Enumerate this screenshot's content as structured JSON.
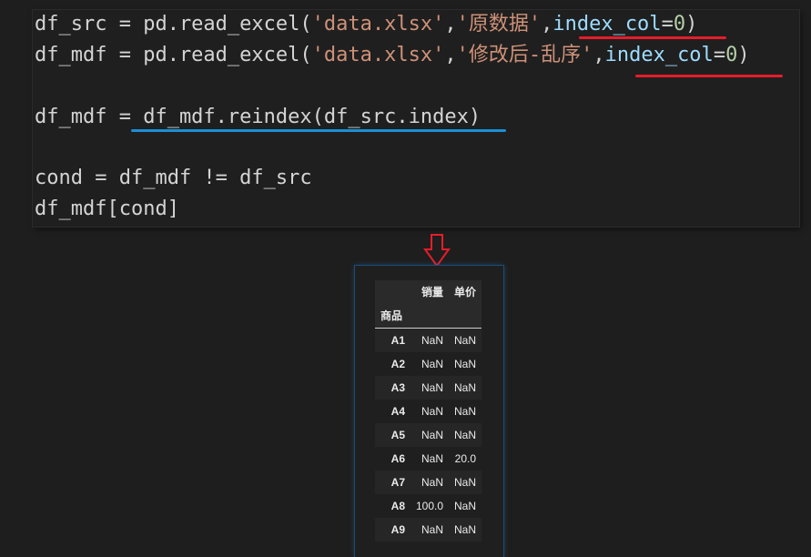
{
  "code": {
    "line1": {
      "a": "df_src = pd.read_excel(",
      "s1": "'data.xlsx'",
      "c1": ",",
      "s2": "'原数据'",
      "c2": ",",
      "kw": "index_col",
      "eq": "=",
      "num": "0",
      "end": ")"
    },
    "line2": {
      "a": "df_mdf = pd.read_excel(",
      "s1": "'data.xlsx'",
      "c1": ",",
      "s2": "'修改后-乱序'",
      "c2": ",",
      "kw": "index_col",
      "eq": "=",
      "num": "0",
      "end": ")"
    },
    "line3": "df_mdf = df_mdf.reindex(df_src.index)",
    "line4": "cond = df_mdf != df_src",
    "line5": "df_mdf[cond]"
  },
  "colors": {
    "red_underline": "#e51d2a",
    "blue_underline": "#1c8fd6",
    "arrow": "#e51d2a"
  },
  "dataframe": {
    "columns": [
      "销量",
      "单价"
    ],
    "index_name": "商品",
    "rows": [
      {
        "idx": "A1",
        "v1": "NaN",
        "v2": "NaN"
      },
      {
        "idx": "A2",
        "v1": "NaN",
        "v2": "NaN"
      },
      {
        "idx": "A3",
        "v1": "NaN",
        "v2": "NaN"
      },
      {
        "idx": "A4",
        "v1": "NaN",
        "v2": "NaN"
      },
      {
        "idx": "A5",
        "v1": "NaN",
        "v2": "NaN"
      },
      {
        "idx": "A6",
        "v1": "NaN",
        "v2": "20.0"
      },
      {
        "idx": "A7",
        "v1": "NaN",
        "v2": "NaN"
      },
      {
        "idx": "A8",
        "v1": "100.0",
        "v2": "NaN"
      },
      {
        "idx": "A9",
        "v1": "NaN",
        "v2": "NaN"
      }
    ]
  }
}
